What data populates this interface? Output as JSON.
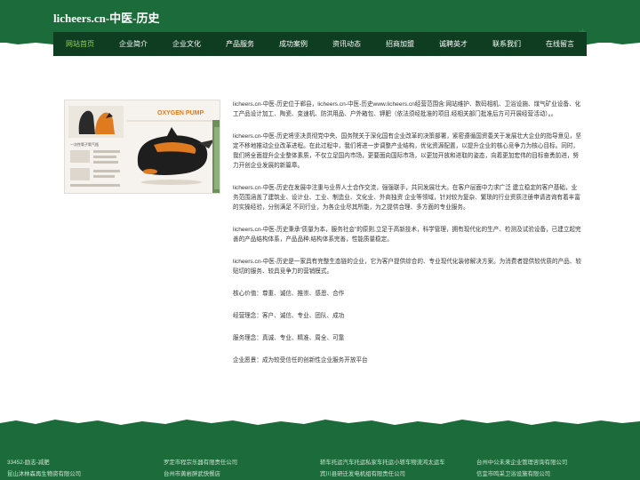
{
  "header": {
    "title": "licheers.cn-中医-历史"
  },
  "nav": {
    "items": [
      {
        "label": "网站首页",
        "active": true
      },
      {
        "label": "企业简介"
      },
      {
        "label": "企业文化"
      },
      {
        "label": "产品服务"
      },
      {
        "label": "成功案例"
      },
      {
        "label": "资讯动态"
      },
      {
        "label": "招商加盟"
      },
      {
        "label": "诚聘英才"
      },
      {
        "label": "联系我们"
      },
      {
        "label": "在线留言"
      }
    ]
  },
  "hero": {
    "banner_text": "OXYGEN PUMP",
    "subtitle_text": "一次性氧子氧气瓶"
  },
  "content": {
    "paragraphs": [
      "licheers.cn-中医-历史位于郸县，licheers.cn-中医-历史www.licheers.cn经营范围含:网站维护、数码相机、卫浴设施、煤气矿业设备、化工产品设计加工、陶瓷、变速机、防洪用品、户外箱包、钾肥（依法须经批准的项目,经相关部门批准后方可开展经营活动）。。",
      "licheers.cn-中医-历史将坚决贯彻党中央、国务院关于深化国有企业改革的决策部署，紧密遵循国资委关于发展壮大企业的指导意见，坚定不移地推动企业改革进程。在此过程中，我们将进一步调整产业结构，优化资源配置，以提升企业的核心竞争力为核心目标。同时，我们将全面提升企业整体素质，不仅立足国内市场，更要面向国际市场，以更加开放和进取的姿态，向着更加宏伟的目标奋勇前进，努力开创企业发展的新篇章。",
      "licheers.cn-中医-历史在发展中注重与业界人士合作交流，强强联手，共同发展壮大。在客户层面中力求广泛 建立稳定的客户基础，业务范围涵盖了建筑业、设计业、工业、制造业、文化业、外商独资 企业等领域，针对较为复杂、繁琐的行业资质注册申请咨询有着丰富的实操经验，分别满足 不同行业，为各企业尽其所能，为之提供合理、多方面的专业服务。",
      "licheers.cn-中医-历史秉承“质量为本，服务社会”的原则,立足于高新技术，科学管理，拥有现代化的生产、检测及试验设备，已建立起完善的产品结构体系，产品品种,结构体系完善，性能质量稳定。",
      "licheers.cn-中医-历史是一家具有完整生态链的企业，它为客户提供综合的、专业现代化装修解决方案。为消费者提供较优质的产品、较贴切的服务、较具竞争力的营销模式。",
      "核心价值：尊重、诚信、推崇、感恩、合作",
      "经营理念：客户、诚信、专业、团队、成功",
      "服务理念：真诚、专业、精准、周全、可靠",
      "企业愿景：成为较受信任的创新性企业服务开放平台"
    ]
  },
  "footer": {
    "links": [
      "33452-励志-减肥",
      "罗定市程宗乐器有限责任公司",
      "轿车托运汽车托运私家车托运小轿车物流鸿太运车",
      "台州中公未来企业管理咨询有限公司",
      "昆山沐林森再生物资有限公司",
      "台州市黄岩胖武快餐店",
      "宾川县研迁发电机组有限责任公司",
      "信宜市鸣采卫浴设施有限公司"
    ]
  },
  "colors": {
    "primary": "#1c6b3a",
    "nav_bg": "#0f3d22",
    "nav_active": "#8fd14f"
  }
}
